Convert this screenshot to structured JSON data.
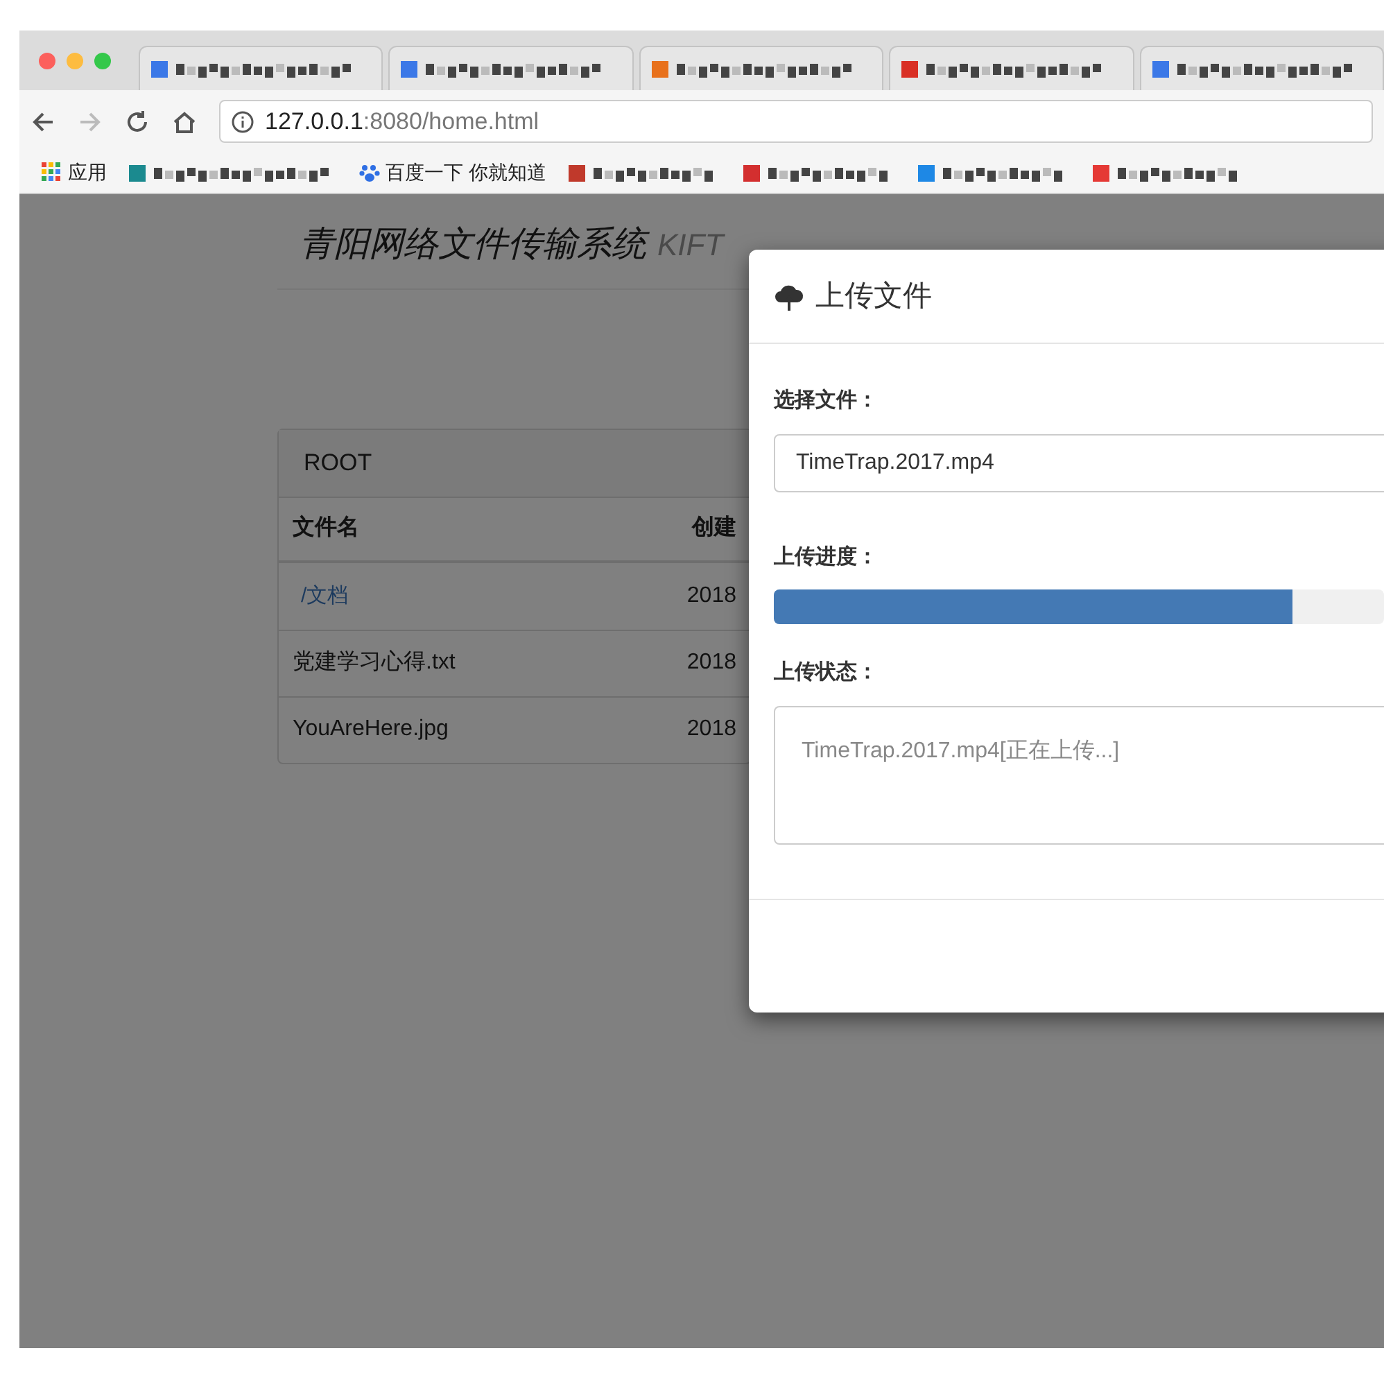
{
  "browser": {
    "tabs": [
      {
        "color": "#3b78e7"
      },
      {
        "color": "#3b78e7"
      },
      {
        "color": "#e8711c"
      },
      {
        "color": "#d93025"
      },
      {
        "color": "#3b78e7"
      }
    ],
    "address": {
      "host": "127.0.0.1",
      "path": ":8080/home.html"
    },
    "bookmarks": [
      {
        "kind": "apps",
        "label": "应用"
      },
      {
        "kind": "blurred",
        "color": "#1b8a8f"
      },
      {
        "kind": "site",
        "label": "百度一下 你就知道"
      },
      {
        "kind": "blurred",
        "color": "#c0392b"
      },
      {
        "kind": "blurred",
        "color": "#d32f2f"
      },
      {
        "kind": "blurred",
        "color": "#1e88e5"
      },
      {
        "kind": "blurred",
        "color": "#e53935"
      }
    ]
  },
  "page": {
    "title": "青阳网络文件传输系统",
    "subtitle": "KIFT",
    "panel": "ROOT",
    "columns": [
      "文件名",
      "创建"
    ],
    "rows": [
      {
        "kind": "folder",
        "name": "/文档",
        "date": "2018"
      },
      {
        "kind": "file",
        "name": "党建学习心得.txt",
        "date": "2018"
      },
      {
        "kind": "file",
        "name": "YouAreHere.jpg",
        "date": "2018"
      }
    ]
  },
  "modal": {
    "title": "上传文件",
    "file_label": "选择文件：",
    "file_value": "TimeTrap.2017.mp4",
    "progress_label": "上传进度：",
    "progress": {
      "level": 0.85
    },
    "status_label": "上传状态：",
    "status_text": "TimeTrap.2017.mp4[正在上传...]"
  }
}
